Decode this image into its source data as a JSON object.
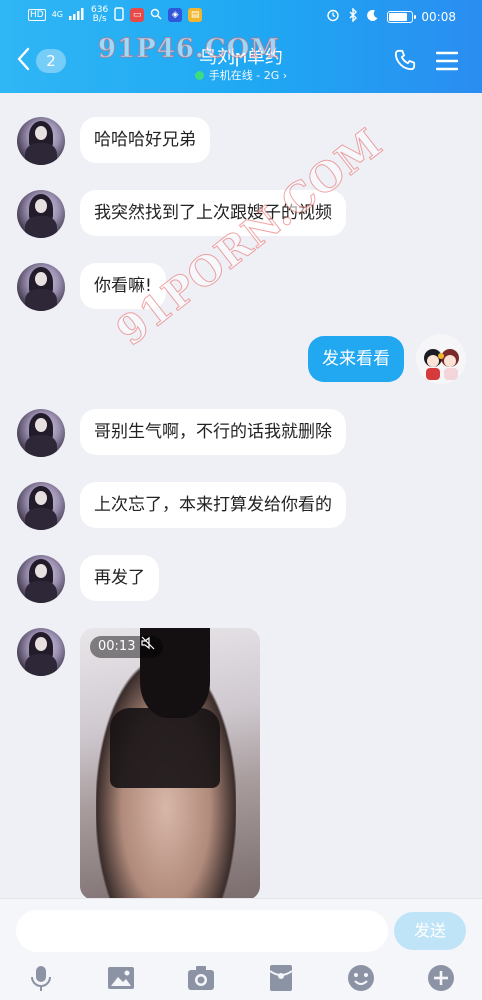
{
  "statusbar": {
    "hd": "HD",
    "net_top": "4G",
    "net_bottom": "",
    "speed_value": "636",
    "speed_unit": "B/s",
    "time": "00:08",
    "battery_level": 0.72
  },
  "header": {
    "back_count": "2",
    "title": "鸟刘ϻ单约",
    "subtitle": "手机在线 - 2G",
    "accent": "#1fa7f3"
  },
  "watermarks": [
    "91P46.COM",
    "91PORN.COM"
  ],
  "messages": [
    {
      "side": "left",
      "text": "哈哈哈好兄弟"
    },
    {
      "side": "left",
      "text": "我突然找到了上次跟嫂子的视频"
    },
    {
      "side": "left",
      "text": "你看嘛!"
    },
    {
      "side": "right",
      "text": "发来看看"
    },
    {
      "side": "left",
      "text": "哥别生气啊，不行的话我就删除"
    },
    {
      "side": "left",
      "text": "上次忘了，本来打算发给你看的"
    },
    {
      "side": "left",
      "text": "再发了"
    }
  ],
  "video": {
    "duration": "00:13",
    "muted": true
  },
  "input": {
    "value": "",
    "placeholder": "",
    "send_label": "发送"
  },
  "toolbar_icons": [
    "mic-icon",
    "image-icon",
    "camera-icon",
    "red-packet-icon",
    "emoji-icon",
    "plus-icon"
  ],
  "colors": {
    "bubble_right": "#22a8f0",
    "background": "#eef0f5",
    "send_disabled": "#bfe3f7"
  }
}
